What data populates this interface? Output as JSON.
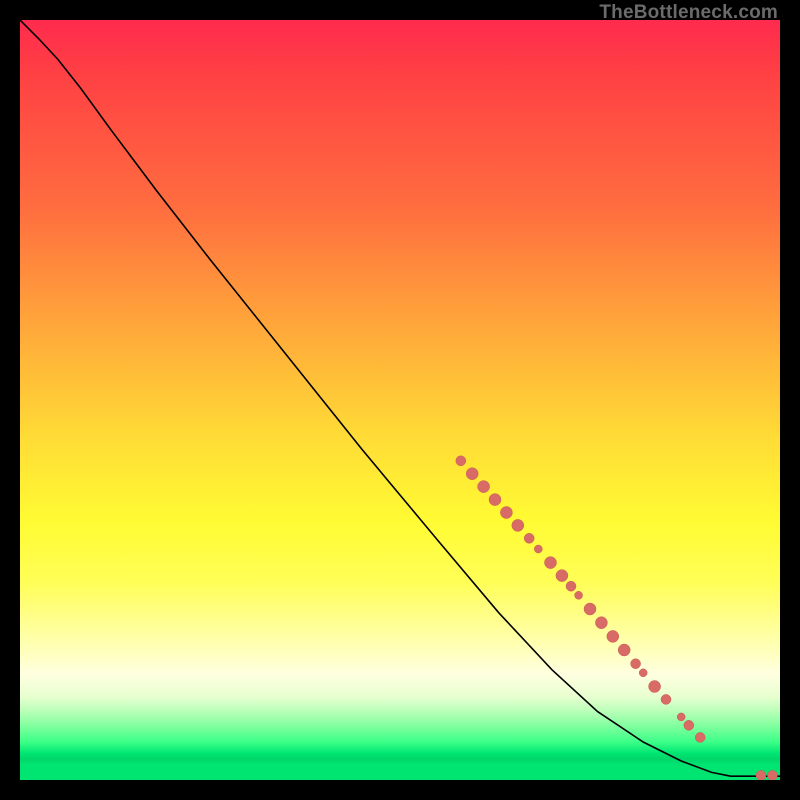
{
  "attribution": "TheBottleneck.com",
  "colors": {
    "curve": "#000000",
    "marker_fill": "#d86b66",
    "marker_stroke": "#c95a55"
  },
  "chart_data": {
    "type": "line",
    "title": "",
    "xlabel": "",
    "ylabel": "",
    "xlim": [
      0,
      100
    ],
    "ylim": [
      0,
      100
    ],
    "curve": [
      {
        "x": 0.0,
        "y": 100.0
      },
      {
        "x": 2.5,
        "y": 97.5
      },
      {
        "x": 5.0,
        "y": 94.8
      },
      {
        "x": 8.0,
        "y": 91.0
      },
      {
        "x": 12.0,
        "y": 85.5
      },
      {
        "x": 18.0,
        "y": 77.5
      },
      {
        "x": 25.0,
        "y": 68.5
      },
      {
        "x": 35.0,
        "y": 56.0
      },
      {
        "x": 45.0,
        "y": 43.5
      },
      {
        "x": 55.0,
        "y": 31.5
      },
      {
        "x": 63.0,
        "y": 22.0
      },
      {
        "x": 70.0,
        "y": 14.5
      },
      {
        "x": 76.0,
        "y": 9.0
      },
      {
        "x": 82.0,
        "y": 5.0
      },
      {
        "x": 87.0,
        "y": 2.5
      },
      {
        "x": 91.0,
        "y": 1.0
      },
      {
        "x": 93.5,
        "y": 0.5
      },
      {
        "x": 96.0,
        "y": 0.5
      },
      {
        "x": 98.0,
        "y": 0.5
      },
      {
        "x": 100.0,
        "y": 0.5
      }
    ],
    "markers": [
      {
        "x": 58.0,
        "y": 42.0,
        "r": 5
      },
      {
        "x": 59.5,
        "y": 40.3,
        "r": 6
      },
      {
        "x": 61.0,
        "y": 38.6,
        "r": 6
      },
      {
        "x": 62.5,
        "y": 36.9,
        "r": 6
      },
      {
        "x": 64.0,
        "y": 35.2,
        "r": 6
      },
      {
        "x": 65.5,
        "y": 33.5,
        "r": 6
      },
      {
        "x": 67.0,
        "y": 31.8,
        "r": 5
      },
      {
        "x": 68.2,
        "y": 30.4,
        "r": 4
      },
      {
        "x": 69.8,
        "y": 28.6,
        "r": 6
      },
      {
        "x": 71.3,
        "y": 26.9,
        "r": 6
      },
      {
        "x": 72.5,
        "y": 25.5,
        "r": 5
      },
      {
        "x": 73.5,
        "y": 24.3,
        "r": 4
      },
      {
        "x": 75.0,
        "y": 22.5,
        "r": 6
      },
      {
        "x": 76.5,
        "y": 20.7,
        "r": 6
      },
      {
        "x": 78.0,
        "y": 18.9,
        "r": 6
      },
      {
        "x": 79.5,
        "y": 17.1,
        "r": 6
      },
      {
        "x": 81.0,
        "y": 15.3,
        "r": 5
      },
      {
        "x": 82.0,
        "y": 14.1,
        "r": 4
      },
      {
        "x": 83.5,
        "y": 12.3,
        "r": 6
      },
      {
        "x": 85.0,
        "y": 10.6,
        "r": 5
      },
      {
        "x": 87.0,
        "y": 8.3,
        "r": 4
      },
      {
        "x": 88.0,
        "y": 7.2,
        "r": 5
      },
      {
        "x": 89.5,
        "y": 5.6,
        "r": 5
      },
      {
        "x": 97.5,
        "y": 0.6,
        "r": 5
      },
      {
        "x": 99.0,
        "y": 0.6,
        "r": 5
      }
    ]
  }
}
